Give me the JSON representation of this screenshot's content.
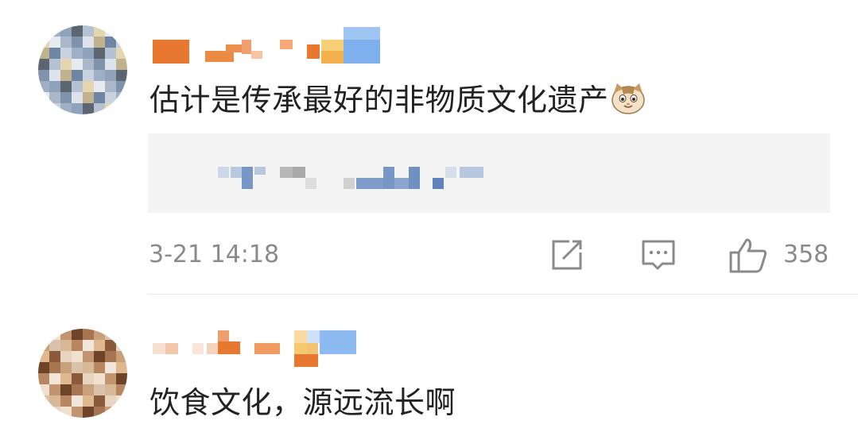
{
  "comments": [
    {
      "text": "估计是传承最好的非物质文化遗产",
      "emoji": "cat-face-emoji",
      "timestamp": "3-21 14:18",
      "like_count": "358",
      "icons": {
        "share": "share-icon",
        "comment": "comment-icon",
        "like": "thumbs-up-icon"
      }
    },
    {
      "text": "饮食文化，源远流长啊"
    }
  ],
  "colors": {
    "text": "#222222",
    "meta": "#8a8a8a",
    "username_orange": "#e8782f",
    "username_blue": "#7fb0ee",
    "reply_background": "#f4f4f4",
    "divider": "#e5e5e5"
  }
}
